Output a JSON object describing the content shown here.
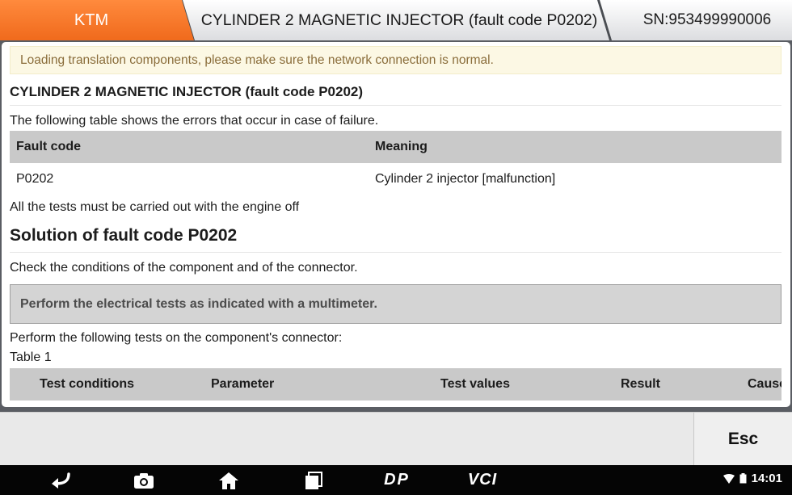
{
  "header": {
    "brand_tab": "KTM",
    "title_tab": "CYLINDER 2 MAGNETIC INJECTOR (fault code P0202)",
    "serial_tab": "SN:953499990006"
  },
  "notice": "Loading translation components, please make sure the network connection is normal.",
  "main": {
    "heading": "CYLINDER 2 MAGNETIC INJECTOR (fault code P0202)",
    "intro": "The following table shows the errors that occur in case of failure.",
    "fault_table": {
      "columns": [
        "Fault code",
        "Meaning"
      ],
      "rows": [
        [
          "P0202",
          "Cylinder 2 injector [malfunction]"
        ]
      ]
    },
    "engine_note": "All the tests must be carried out with the engine off",
    "solution_heading": "Solution of fault code P0202",
    "check_text": "Check the conditions of the component and of the connector.",
    "callout": "Perform the electrical tests as indicated with a multimeter.",
    "connector_text": "Perform the following tests on the component's connector:",
    "table_label": "Table 1",
    "test_table": {
      "columns": [
        "Test conditions",
        "Parameter",
        "Test values",
        "Result",
        "Cause"
      ]
    }
  },
  "bottom": {
    "esc_label": "Esc"
  },
  "nav": {
    "icons": [
      "back-icon",
      "camera-icon",
      "home-icon",
      "recents-icon"
    ],
    "dp_label": "DP",
    "vci_label": "VCI",
    "time": "14:01"
  },
  "colors": {
    "brand_orange": "#f37021",
    "notice_bg": "#fcf8e4",
    "notice_text": "#8a6d3b",
    "table_header": "#c9c9c9"
  }
}
